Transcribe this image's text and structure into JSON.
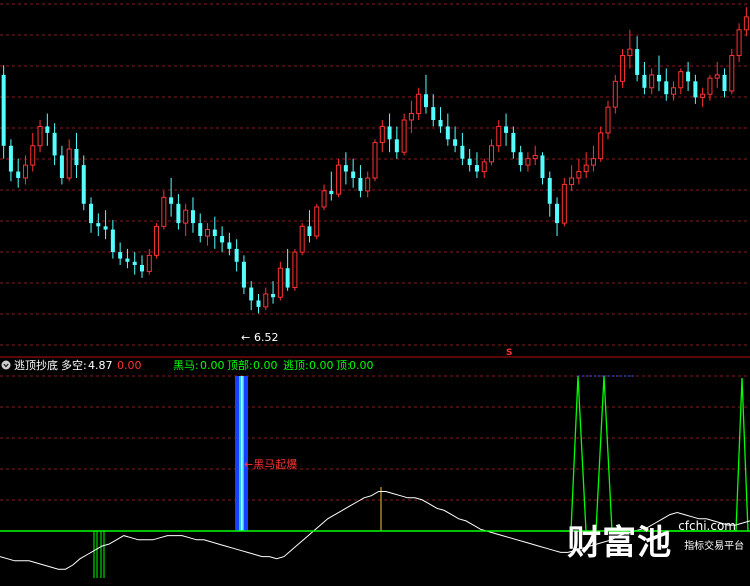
{
  "indicator_header": {
    "name": "逃顶抄底",
    "duokong_label": "多空:",
    "duokong_value": "4.87",
    "extra_value": "0.00",
    "heima_label": "黑马:",
    "heima_value": "0.00",
    "dingbu_label": "顶部:",
    "dingbu_value": "0.00",
    "taoding_label": "逃顶:",
    "taoding_value": "0.00",
    "ding_label": "顶:",
    "ding_value": "0.00"
  },
  "annotations": {
    "low_marker": "6.52",
    "heima_signal": "黑马起爆",
    "s_marker": "S"
  },
  "watermark": {
    "main": "财富池",
    "url": "cfchi.com",
    "sub": "指标交易平台"
  },
  "colors": {
    "background": "#000000",
    "up_candle": "#ff3232",
    "down_candle": "#54ffff",
    "grid": "#8a1a1a",
    "indicator_line": "#ffffff",
    "green_signal": "#00ff00",
    "blue_signal": "#2060ff",
    "yellow_signal": "#d4a020"
  },
  "chart_data": [
    {
      "type": "candlestick",
      "title": "",
      "ylim": [
        5.9,
        11.3
      ],
      "low_annotation": 6.52,
      "candles": [
        [
          10.2,
          10.35,
          9.1,
          8.9
        ],
        [
          9.1,
          9.2,
          8.7,
          8.55
        ],
        [
          8.7,
          8.9,
          8.6,
          8.45
        ],
        [
          8.6,
          8.95,
          8.8,
          8.5
        ],
        [
          8.8,
          9.3,
          9.1,
          8.7
        ],
        [
          9.1,
          9.5,
          9.4,
          9.0
        ],
        [
          9.4,
          9.6,
          9.3,
          9.1
        ],
        [
          9.3,
          9.45,
          8.95,
          8.8
        ],
        [
          8.95,
          9.1,
          8.6,
          8.5
        ],
        [
          8.6,
          9.2,
          9.05,
          8.55
        ],
        [
          9.05,
          9.3,
          8.8,
          8.6
        ],
        [
          8.8,
          8.95,
          8.2,
          8.1
        ],
        [
          8.2,
          8.3,
          7.9,
          7.75
        ],
        [
          7.9,
          8.05,
          7.85,
          7.7
        ],
        [
          7.85,
          8.1,
          7.8,
          7.65
        ],
        [
          7.8,
          7.95,
          7.45,
          7.35
        ],
        [
          7.45,
          7.6,
          7.35,
          7.25
        ],
        [
          7.35,
          7.5,
          7.3,
          7.2
        ],
        [
          7.3,
          7.45,
          7.25,
          7.1
        ],
        [
          7.25,
          7.4,
          7.15,
          7.05
        ],
        [
          7.15,
          7.5,
          7.4,
          7.1
        ],
        [
          7.4,
          7.9,
          7.85,
          7.35
        ],
        [
          7.85,
          8.4,
          8.3,
          7.8
        ],
        [
          8.3,
          8.6,
          8.2,
          8.0
        ],
        [
          8.2,
          8.35,
          7.9,
          7.8
        ],
        [
          7.9,
          8.2,
          8.1,
          7.7
        ],
        [
          8.1,
          8.3,
          7.9,
          7.75
        ],
        [
          7.9,
          8.05,
          7.7,
          7.6
        ],
        [
          7.7,
          7.9,
          7.8,
          7.55
        ],
        [
          7.8,
          8.0,
          7.7,
          7.5
        ],
        [
          7.7,
          7.85,
          7.6,
          7.45
        ],
        [
          7.6,
          7.75,
          7.5,
          7.4
        ],
        [
          7.5,
          7.65,
          7.3,
          7.15
        ],
        [
          7.3,
          7.4,
          6.9,
          6.8
        ],
        [
          6.9,
          7.0,
          6.7,
          6.55
        ],
        [
          6.7,
          6.8,
          6.6,
          6.5
        ],
        [
          6.6,
          6.9,
          6.8,
          6.55
        ],
        [
          6.8,
          7.0,
          6.75,
          6.65
        ],
        [
          6.75,
          7.3,
          7.2,
          6.7
        ],
        [
          7.2,
          7.5,
          6.9,
          6.85
        ],
        [
          6.9,
          7.5,
          7.45,
          6.85
        ],
        [
          7.45,
          7.9,
          7.85,
          7.4
        ],
        [
          7.85,
          8.1,
          7.7,
          7.6
        ],
        [
          7.7,
          8.2,
          8.15,
          7.65
        ],
        [
          8.15,
          8.5,
          8.4,
          8.1
        ],
        [
          8.4,
          8.7,
          8.35,
          8.25
        ],
        [
          8.35,
          8.9,
          8.8,
          8.3
        ],
        [
          8.8,
          9.0,
          8.7,
          8.5
        ],
        [
          8.7,
          8.9,
          8.6,
          8.45
        ],
        [
          8.6,
          8.8,
          8.4,
          8.3
        ],
        [
          8.4,
          8.7,
          8.6,
          8.3
        ],
        [
          8.6,
          9.2,
          9.15,
          8.55
        ],
        [
          9.15,
          9.5,
          9.4,
          9.0
        ],
        [
          9.4,
          9.6,
          9.2,
          9.0
        ],
        [
          9.2,
          9.4,
          9.0,
          8.9
        ],
        [
          9.0,
          9.6,
          9.5,
          8.95
        ],
        [
          9.5,
          9.8,
          9.6,
          9.3
        ],
        [
          9.6,
          10.0,
          9.9,
          9.5
        ],
        [
          9.9,
          10.2,
          9.7,
          9.6
        ],
        [
          9.7,
          9.9,
          9.5,
          9.4
        ],
        [
          9.5,
          9.7,
          9.4,
          9.3
        ],
        [
          9.4,
          9.6,
          9.2,
          9.1
        ],
        [
          9.2,
          9.4,
          9.1,
          9.0
        ],
        [
          9.1,
          9.3,
          8.9,
          8.8
        ],
        [
          8.9,
          9.05,
          8.8,
          8.7
        ],
        [
          8.8,
          9.0,
          8.7,
          8.6
        ],
        [
          8.7,
          8.9,
          8.85,
          8.6
        ],
        [
          8.85,
          9.2,
          9.1,
          8.8
        ],
        [
          9.1,
          9.5,
          9.4,
          9.0
        ],
        [
          9.4,
          9.6,
          9.3,
          9.1
        ],
        [
          9.3,
          9.4,
          9.0,
          8.9
        ],
        [
          9.0,
          9.1,
          8.8,
          8.7
        ],
        [
          8.8,
          9.0,
          8.9,
          8.7
        ],
        [
          8.9,
          9.1,
          8.95,
          8.8
        ],
        [
          8.95,
          9.0,
          8.6,
          8.5
        ],
        [
          8.6,
          8.7,
          8.2,
          8.0
        ],
        [
          8.2,
          8.3,
          7.9,
          7.7
        ],
        [
          7.9,
          8.6,
          8.5,
          7.85
        ],
        [
          8.5,
          8.8,
          8.6,
          8.4
        ],
        [
          8.6,
          8.9,
          8.7,
          8.5
        ],
        [
          8.7,
          9.0,
          8.8,
          8.6
        ],
        [
          8.8,
          9.1,
          8.9,
          8.7
        ],
        [
          8.9,
          9.4,
          9.3,
          8.85
        ],
        [
          9.3,
          9.8,
          9.7,
          9.2
        ],
        [
          9.7,
          10.2,
          10.1,
          9.6
        ],
        [
          10.1,
          10.6,
          10.5,
          10.0
        ],
        [
          10.5,
          10.9,
          10.6,
          10.3
        ],
        [
          10.6,
          10.8,
          10.2,
          10.1
        ],
        [
          10.2,
          10.4,
          10.0,
          9.9
        ],
        [
          10.0,
          10.3,
          10.2,
          9.9
        ],
        [
          10.2,
          10.5,
          10.1,
          9.95
        ],
        [
          10.1,
          10.3,
          9.9,
          9.8
        ],
        [
          9.9,
          10.1,
          10.0,
          9.8
        ],
        [
          10.0,
          10.3,
          10.25,
          9.9
        ],
        [
          10.25,
          10.4,
          10.1,
          9.95
        ],
        [
          10.1,
          10.2,
          9.85,
          9.75
        ],
        [
          9.85,
          10.0,
          9.9,
          9.7
        ],
        [
          9.9,
          10.2,
          10.15,
          9.8
        ],
        [
          10.15,
          10.4,
          10.2,
          10.0
        ],
        [
          10.2,
          10.3,
          9.95,
          9.85
        ],
        [
          9.95,
          10.6,
          10.5,
          9.9
        ],
        [
          10.5,
          11.0,
          10.9,
          10.4
        ],
        [
          10.9,
          11.25,
          11.1,
          10.8
        ]
      ]
    },
    {
      "type": "line",
      "title": "",
      "ylim": [
        0,
        100
      ],
      "series": [
        {
          "values": [
            14,
            13,
            12,
            12,
            12,
            11,
            10,
            9,
            8,
            8,
            10,
            13,
            15,
            17,
            19,
            20,
            22,
            24,
            23,
            22,
            22,
            22,
            23,
            24,
            24,
            24,
            23,
            22,
            22,
            21,
            20,
            19,
            18,
            17,
            16,
            15,
            14,
            14,
            13,
            14,
            17,
            20,
            23,
            26,
            29,
            32,
            34,
            36,
            38,
            40,
            42,
            43,
            45,
            45,
            44,
            43,
            42,
            42,
            41,
            39,
            37,
            36,
            34,
            32,
            31,
            29,
            27,
            26,
            25,
            24,
            23,
            22,
            21,
            20,
            19,
            18,
            17,
            16,
            16,
            17,
            18,
            19,
            20,
            21,
            22,
            24,
            25,
            26,
            27,
            28,
            30,
            32,
            34,
            35,
            34,
            33,
            32,
            32,
            31,
            30,
            29,
            29,
            30,
            31
          ]
        }
      ]
    }
  ]
}
